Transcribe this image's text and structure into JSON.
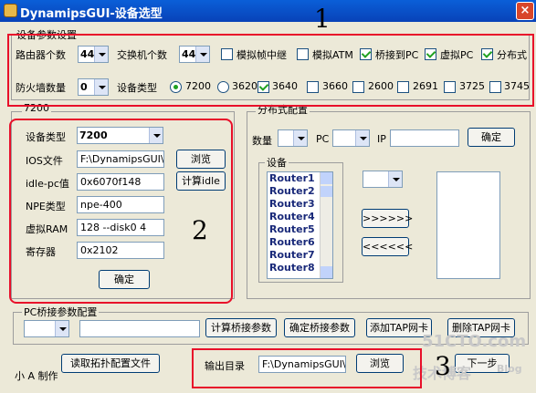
{
  "window": {
    "title": "DynamipsGUI-设备选型",
    "close_glyph": "×"
  },
  "device_params": {
    "legend": "设备参数设置",
    "router_count_label": "路由器个数",
    "router_count": "44",
    "switch_count_label": "交换机个数",
    "switch_count": "44",
    "cb_frame_relay": "模拟帧中继",
    "cb_atm": "模拟ATM",
    "cb_bridge_pc": "桥接到PC",
    "cb_virtual_pc": "虚拟PC",
    "cb_distributed": "分布式",
    "firewall_count_label": "防火墙数量",
    "firewall_count": "0",
    "device_type_label": "设备类型",
    "types": [
      "7200",
      "3620",
      "3640",
      "3660",
      "2600",
      "2691",
      "3725",
      "3745"
    ]
  },
  "annotations": {
    "one": "1",
    "two": "2",
    "three": "3"
  },
  "router_group": {
    "legend": "7200",
    "device_type_label": "设备类型",
    "device_type": "7200",
    "ios_label": "IOS文件",
    "ios_value": "F:\\DynamipsGUI\\bir",
    "browse": "浏览",
    "idlepc_label": "idle-pc值",
    "idlepc_value": "0x6070f148",
    "calc_idle": "计算idle",
    "npe_label": "NPE类型",
    "npe_value": "npe-400",
    "ram_label": "虚拟RAM",
    "ram_value": "128 --disk0 4",
    "reg_label": "寄存器",
    "reg_value": "0x2102",
    "ok": "确定"
  },
  "distributed": {
    "legend": "分布式配置",
    "count_label": "数量",
    "pc_label": "PC",
    "ip_label": "IP",
    "ok": "确定",
    "devices_legend": "设备",
    "devices": [
      "Router1",
      "Router2",
      "Router3",
      "Router4",
      "Router5",
      "Router6",
      "Router7",
      "Router8"
    ],
    "move_right": ">>>>>>",
    "move_left": "<<<<<<"
  },
  "pc_bridge": {
    "legend": "PC桥接参数配置",
    "calc": "计算桥接参数",
    "confirm": "确定桥接参数",
    "add_tap": "添加TAP网卡",
    "del_tap": "删除TAP网卡"
  },
  "footer": {
    "author": "小 A 制作",
    "read_topo": "读取拓扑配置文件",
    "output_label": "输出目录",
    "output_value": "F:\\DynamipsGUI\\ou",
    "browse": "浏览",
    "next": "下一步"
  },
  "watermark": {
    "line1": "51CTO.com",
    "line2": "技术博客",
    "line3": "Blog"
  },
  "colors": {
    "annotation_red": "#e8102a",
    "title_blue": "#0a5fd8"
  }
}
